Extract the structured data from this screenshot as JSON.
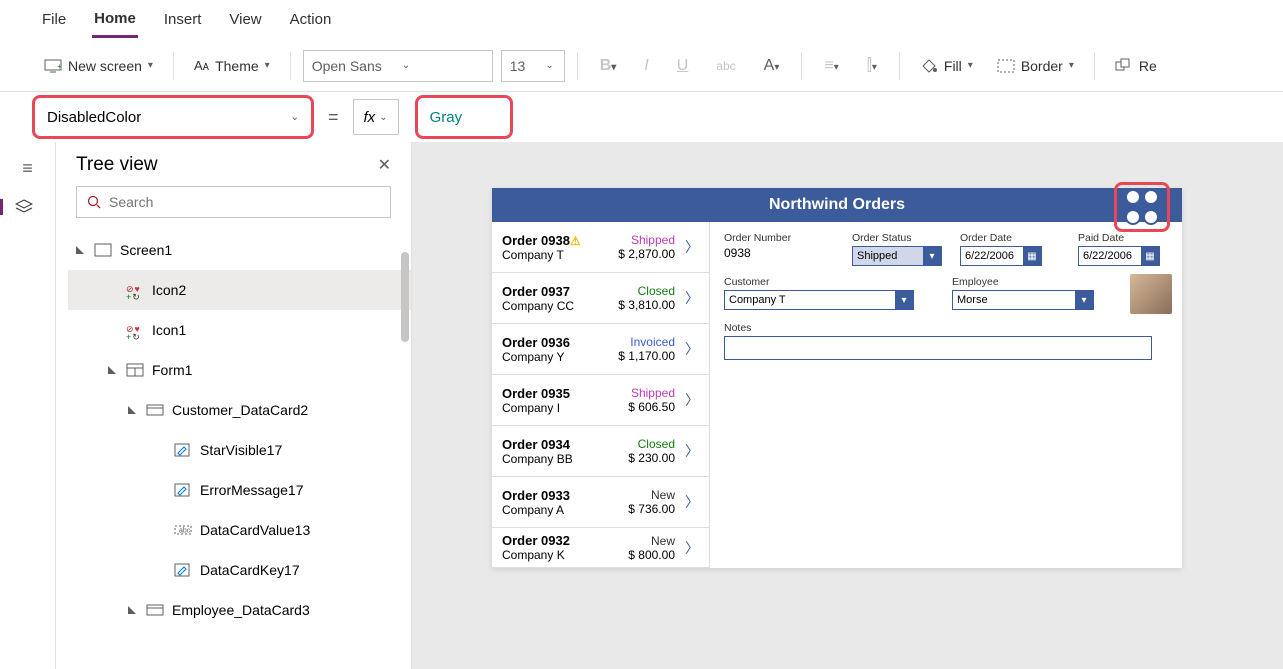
{
  "menu": {
    "items": [
      "File",
      "Home",
      "Insert",
      "View",
      "Action"
    ],
    "activeIndex": 1
  },
  "toolbar": {
    "new_screen": "New screen",
    "theme": "Theme",
    "font": "Open Sans",
    "font_size": "13",
    "fill": "Fill",
    "border": "Border",
    "reorder": "Re"
  },
  "formula": {
    "property": "DisabledColor",
    "value": "Gray"
  },
  "tree": {
    "title": "Tree view",
    "search_placeholder": "Search",
    "items": [
      {
        "label": "Screen1",
        "level": 0,
        "expand": true,
        "icon": "screen"
      },
      {
        "label": "Icon2",
        "level": 1,
        "icon": "tri",
        "selected": true
      },
      {
        "label": "Icon1",
        "level": 1,
        "icon": "tri"
      },
      {
        "label": "Form1",
        "level": 1,
        "expand": true,
        "icon": "form"
      },
      {
        "label": "Customer_DataCard2",
        "level": 2,
        "expand": true,
        "icon": "card"
      },
      {
        "label": "StarVisible17",
        "level": 3,
        "icon": "edit"
      },
      {
        "label": "ErrorMessage17",
        "level": 3,
        "icon": "edit"
      },
      {
        "label": "DataCardValue13",
        "level": 3,
        "icon": "input"
      },
      {
        "label": "DataCardKey17",
        "level": 3,
        "icon": "edit"
      },
      {
        "label": "Employee_DataCard3",
        "level": 2,
        "expand": true,
        "icon": "card"
      }
    ]
  },
  "app": {
    "title": "Northwind Orders",
    "orders": [
      {
        "id": "Order 0938",
        "company": "Company T",
        "status": "Shipped",
        "statusClass": "shipped",
        "amount": "$ 2,870.00",
        "warn": true
      },
      {
        "id": "Order 0937",
        "company": "Company CC",
        "status": "Closed",
        "statusClass": "closed",
        "amount": "$ 3,810.00"
      },
      {
        "id": "Order 0936",
        "company": "Company Y",
        "status": "Invoiced",
        "statusClass": "invoiced",
        "amount": "$ 1,170.00"
      },
      {
        "id": "Order 0935",
        "company": "Company I",
        "status": "Shipped",
        "statusClass": "shipped",
        "amount": "$ 606.50"
      },
      {
        "id": "Order 0934",
        "company": "Company BB",
        "status": "Closed",
        "statusClass": "closed",
        "amount": "$ 230.00"
      },
      {
        "id": "Order 0933",
        "company": "Company A",
        "status": "New",
        "statusClass": "new",
        "amount": "$ 736.00"
      },
      {
        "id": "Order 0932",
        "company": "Company K",
        "status": "New",
        "statusClass": "new",
        "amount": "$ 800.00"
      }
    ],
    "detail": {
      "labels": {
        "order_number": "Order Number",
        "order_status": "Order Status",
        "order_date": "Order Date",
        "paid_date": "Paid Date",
        "customer": "Customer",
        "employee": "Employee",
        "notes": "Notes"
      },
      "order_number": "0938",
      "order_status": "Shipped",
      "order_date": "6/22/2006",
      "paid_date": "6/22/2006",
      "customer": "Company T",
      "employee": "Morse"
    }
  }
}
